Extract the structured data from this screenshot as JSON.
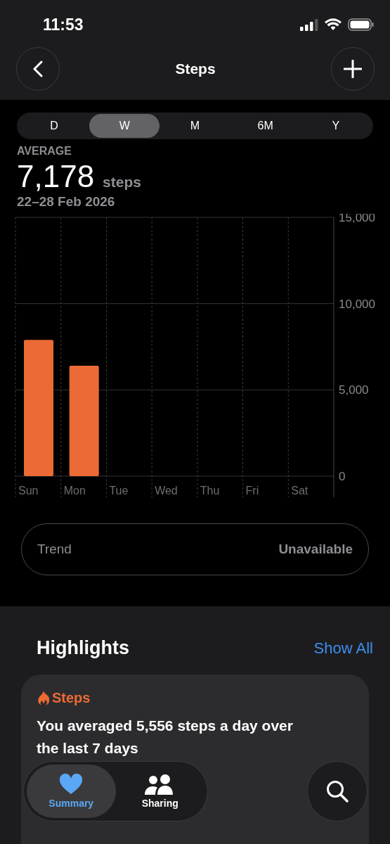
{
  "status_bar": {
    "time": "11:53"
  },
  "header": {
    "title": "Steps"
  },
  "ranges": [
    {
      "label": "D",
      "selected": false
    },
    {
      "label": "W",
      "selected": true
    },
    {
      "label": "M",
      "selected": false
    },
    {
      "label": "6M",
      "selected": false
    },
    {
      "label": "Y",
      "selected": false
    }
  ],
  "summary": {
    "label": "AVERAGE",
    "value": "7,178",
    "unit": "steps",
    "date_range": "22–28 Feb 2026"
  },
  "chart_data": {
    "type": "bar",
    "categories": [
      "Sun",
      "Mon",
      "Tue",
      "Wed",
      "Thu",
      "Fri",
      "Sat"
    ],
    "series": [
      {
        "color": "#ec6a35",
        "values": [
          7900,
          6400,
          null,
          null,
          null,
          null,
          null
        ]
      }
    ],
    "ylim": [
      0,
      15000
    ],
    "yticks": [
      {
        "value": 0,
        "label": "0"
      },
      {
        "value": 5000,
        "label": "5,000"
      },
      {
        "value": 10000,
        "label": "10,000"
      },
      {
        "value": 15000,
        "label": "15,000"
      }
    ]
  },
  "trend": {
    "label": "Trend",
    "value": "Unavailable"
  },
  "highlights": {
    "title": "Highlights",
    "link": "Show All",
    "card": {
      "title": "Steps",
      "text": "You averaged 5,556 steps a day over the last 7 days"
    }
  },
  "tab_bar": [
    {
      "label": "Summary",
      "kind": "heart",
      "selected": true
    },
    {
      "label": "Sharing",
      "kind": "people",
      "selected": false
    }
  ]
}
